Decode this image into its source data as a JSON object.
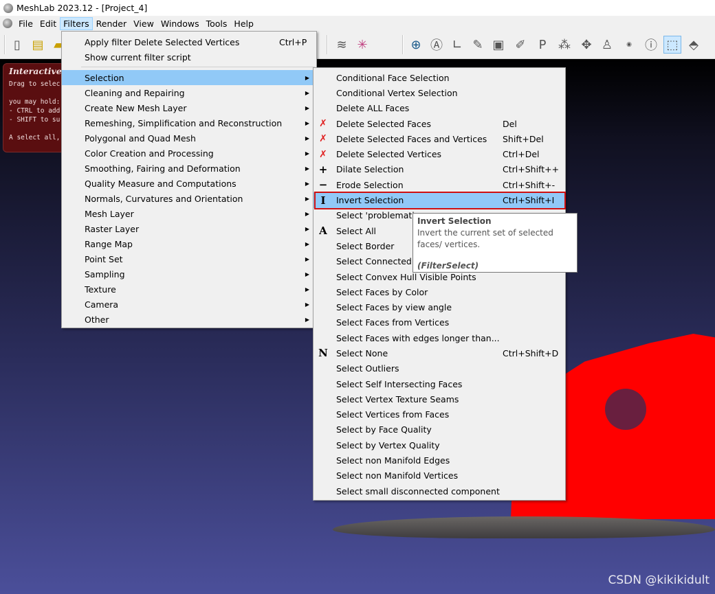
{
  "window": {
    "title": "MeshLab 2023.12 - [Project_4]"
  },
  "menubar": {
    "items": [
      "File",
      "Edit",
      "Filters",
      "Render",
      "View",
      "Windows",
      "Tools",
      "Help"
    ]
  },
  "toolbar": {
    "icons": [
      "new-file-icon",
      "open-project-icon",
      "import-mesh-icon",
      "layers-icon",
      "axes-icon",
      "globe-icon",
      "annotate-icon",
      "measure-icon",
      "paint-icon",
      "snapshot-icon",
      "brush-icon",
      "pickpoints-icon",
      "align-icon",
      "vertex-edit-icon",
      "manipulator-icon",
      "georef-icon",
      "info-icon",
      "select-faces-icon",
      "select-vertices-icon"
    ]
  },
  "info_panel": {
    "title": "Interactive",
    "lines": [
      "Drag to selec",
      "",
      "you may hold:",
      "- CTRL to add",
      "- SHIFT to su",
      "",
      "A select all,"
    ]
  },
  "filters_menu": {
    "top_items": [
      {
        "label": "Apply filter Delete Selected Vertices",
        "shortcut": "Ctrl+P"
      },
      {
        "label": "Show current filter script",
        "shortcut": ""
      }
    ],
    "categories": [
      "Selection",
      "Cleaning and Repairing",
      "Create New Mesh Layer",
      "Remeshing, Simplification and Reconstruction",
      "Polygonal and Quad Mesh",
      "Color Creation and Processing",
      "Smoothing, Fairing and Deformation",
      "Quality Measure and Computations",
      "Normals, Curvatures and Orientation",
      "Mesh Layer",
      "Raster Layer",
      "Range Map",
      "Point Set",
      "Sampling",
      "Texture",
      "Camera",
      "Other"
    ]
  },
  "selection_menu": {
    "items": [
      {
        "label": "Conditional Face Selection",
        "shortcut": "",
        "icon": ""
      },
      {
        "label": "Conditional Vertex Selection",
        "shortcut": "",
        "icon": ""
      },
      {
        "label": "Delete ALL Faces",
        "shortcut": "",
        "icon": ""
      },
      {
        "label": "Delete Selected Faces",
        "shortcut": "Del",
        "icon": "✗"
      },
      {
        "label": "Delete Selected Faces and Vertices",
        "shortcut": "Shift+Del",
        "icon": "✗"
      },
      {
        "label": "Delete Selected Vertices",
        "shortcut": "Ctrl+Del",
        "icon": "✗"
      },
      {
        "label": "Dilate Selection",
        "shortcut": "Ctrl+Shift++",
        "icon": "+"
      },
      {
        "label": "Erode Selection",
        "shortcut": "Ctrl+Shift+-",
        "icon": "−"
      },
      {
        "label": "Invert Selection",
        "shortcut": "Ctrl+Shift+I",
        "icon": "I"
      },
      {
        "label": "Select 'problematic",
        "shortcut": "",
        "icon": ""
      },
      {
        "label": "Select All",
        "shortcut": "",
        "icon": "A"
      },
      {
        "label": "Select Border",
        "shortcut": "",
        "icon": ""
      },
      {
        "label": "Select Connected F",
        "shortcut": "",
        "icon": ""
      },
      {
        "label": "Select Convex Hull Visible Points",
        "shortcut": "",
        "icon": ""
      },
      {
        "label": "Select Faces by Color",
        "shortcut": "",
        "icon": ""
      },
      {
        "label": "Select Faces by view angle",
        "shortcut": "",
        "icon": ""
      },
      {
        "label": "Select Faces from Vertices",
        "shortcut": "",
        "icon": ""
      },
      {
        "label": "Select Faces with edges longer than...",
        "shortcut": "",
        "icon": ""
      },
      {
        "label": "Select None",
        "shortcut": "Ctrl+Shift+D",
        "icon": "N"
      },
      {
        "label": "Select Outliers",
        "shortcut": "",
        "icon": ""
      },
      {
        "label": "Select Self Intersecting Faces",
        "shortcut": "",
        "icon": ""
      },
      {
        "label": "Select Vertex Texture Seams",
        "shortcut": "",
        "icon": ""
      },
      {
        "label": "Select Vertices from Faces",
        "shortcut": "",
        "icon": ""
      },
      {
        "label": "Select by Face Quality",
        "shortcut": "",
        "icon": ""
      },
      {
        "label": "Select by Vertex Quality",
        "shortcut": "",
        "icon": ""
      },
      {
        "label": "Select non Manifold Edges",
        "shortcut": "",
        "icon": ""
      },
      {
        "label": "Select non Manifold Vertices",
        "shortcut": "",
        "icon": ""
      },
      {
        "label": "Select small disconnected component",
        "shortcut": "",
        "icon": ""
      }
    ],
    "highlighted": "Invert Selection"
  },
  "tooltip": {
    "title": "Invert Selection",
    "body": "Invert the current set of selected faces/ vertices.",
    "filter": "(FilterSelect)"
  },
  "watermark": "CSDN @kikikidult",
  "colors": {
    "mesh": "#ff0000",
    "highlight": "#91c9f7",
    "outline": "#d01010"
  }
}
